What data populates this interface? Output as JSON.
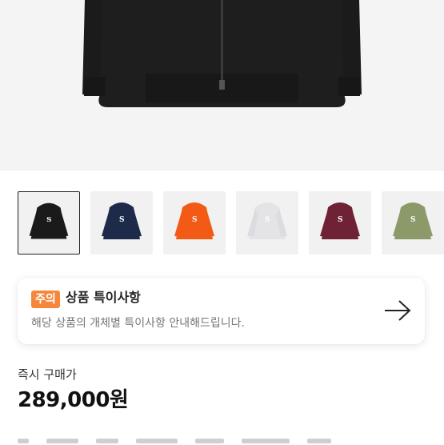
{
  "colors": {
    "badge": "#f5873d",
    "hero_bg": "#f4f4f4"
  },
  "thumbnails": [
    {
      "color": "black",
      "hex": "#1a1a1a",
      "selected": true
    },
    {
      "color": "navy",
      "hex": "#1e2a4a",
      "selected": false
    },
    {
      "color": "orange",
      "hex": "#f25a16",
      "selected": false
    },
    {
      "color": "light gray",
      "hex": "#e6e6e8",
      "selected": false
    },
    {
      "color": "burgundy",
      "hex": "#6e2233",
      "selected": false
    },
    {
      "color": "olive",
      "hex": "#8c9a6a",
      "selected": false
    }
  ],
  "notice": {
    "badge": "주의",
    "title": "상품 특이사항",
    "description": "해당 상품의 개체별 특이사항 안내해드립니다.",
    "arrow_icon": "arrow-right-icon"
  },
  "purchase": {
    "label": "즉시 구매가",
    "price": "289,000원"
  }
}
